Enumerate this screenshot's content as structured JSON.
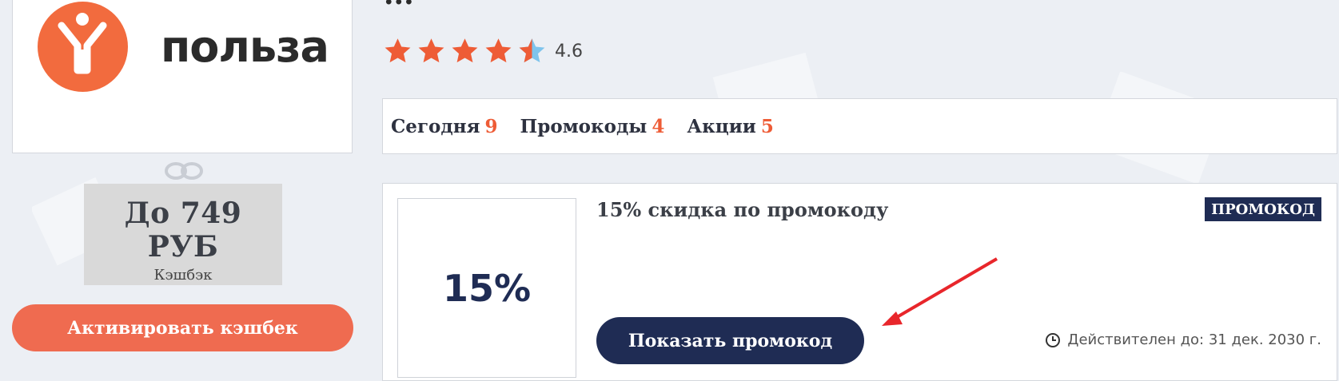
{
  "brand": {
    "logo_text": "польза",
    "accent_color": "#f26b3e"
  },
  "title": "...",
  "rating": {
    "value": "4.6",
    "stars_filled": 4.6,
    "stars_total": 5,
    "star_color": "#ee5c36"
  },
  "tabs": [
    {
      "label": "Сегодня",
      "count": "9"
    },
    {
      "label": "Промокоды",
      "count": "4"
    },
    {
      "label": "Акции",
      "count": "5"
    }
  ],
  "cashback": {
    "amount": "До 749 РУБ",
    "label": "Кэшбэк",
    "button": "Активировать кэшбек"
  },
  "offer": {
    "thumb_text": "15%",
    "title": "15% скидка по промокоду",
    "badge": "ПРОМОКОД",
    "button": "Показать промокод",
    "validity": "Действителен до: 31 дек. 2030 г."
  },
  "colors": {
    "navy": "#1f2c54",
    "orange": "#ef6b50",
    "arrow": "#e8262b"
  }
}
